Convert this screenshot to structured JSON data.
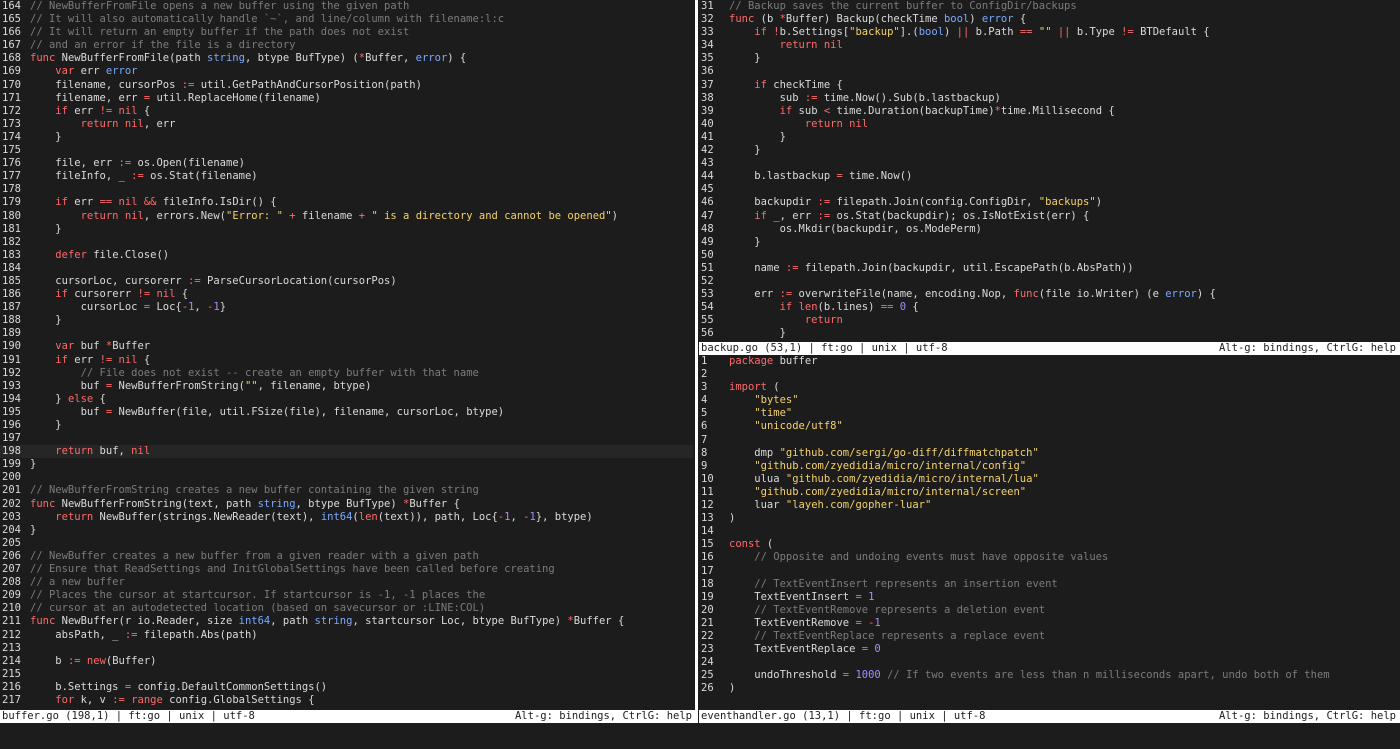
{
  "left_pane": {
    "status_left": "buffer.go (198,1) | ft:go | unix | utf-8",
    "status_right": "Alt-g: bindings, CtrlG: help",
    "cursor_line": "198",
    "lines": [
      [
        "164",
        "// NewBufferFromFile opens a new buffer using the given path"
      ],
      [
        "165",
        "// It will also automatically handle `~`, and line/column with filename:l:c"
      ],
      [
        "166",
        "// It will return an empty buffer if the path does not exist"
      ],
      [
        "167",
        "// and an error if the file is a directory"
      ],
      [
        "168",
        "func NewBufferFromFile(path string, btype BufType) (*Buffer, error) {"
      ],
      [
        "169",
        "    var err error"
      ],
      [
        "170",
        "    filename, cursorPos := util.GetPathAndCursorPosition(path)"
      ],
      [
        "171",
        "    filename, err = util.ReplaceHome(filename)"
      ],
      [
        "172",
        "    if err != nil {"
      ],
      [
        "173",
        "        return nil, err"
      ],
      [
        "174",
        "    }"
      ],
      [
        "175",
        ""
      ],
      [
        "176",
        "    file, err := os.Open(filename)"
      ],
      [
        "177",
        "    fileInfo, _ := os.Stat(filename)"
      ],
      [
        "178",
        ""
      ],
      [
        "179",
        "    if err == nil && fileInfo.IsDir() {"
      ],
      [
        "180",
        "        return nil, errors.New(\"Error: \" + filename + \" is a directory and cannot be opened\")"
      ],
      [
        "181",
        "    }"
      ],
      [
        "182",
        ""
      ],
      [
        "183",
        "    defer file.Close()"
      ],
      [
        "184",
        ""
      ],
      [
        "185",
        "    cursorLoc, cursorerr := ParseCursorLocation(cursorPos)"
      ],
      [
        "186",
        "    if cursorerr != nil {"
      ],
      [
        "187",
        "        cursorLoc = Loc{-1, -1}"
      ],
      [
        "188",
        "    }"
      ],
      [
        "189",
        ""
      ],
      [
        "190",
        "    var buf *Buffer"
      ],
      [
        "191",
        "    if err != nil {"
      ],
      [
        "192",
        "        // File does not exist -- create an empty buffer with that name"
      ],
      [
        "193",
        "        buf = NewBufferFromString(\"\", filename, btype)"
      ],
      [
        "194",
        "    } else {"
      ],
      [
        "195",
        "        buf = NewBuffer(file, util.FSize(file), filename, cursorLoc, btype)"
      ],
      [
        "196",
        "    }"
      ],
      [
        "197",
        ""
      ],
      [
        "198",
        "    return buf, nil"
      ],
      [
        "199",
        "}"
      ],
      [
        "200",
        ""
      ],
      [
        "201",
        "// NewBufferFromString creates a new buffer containing the given string"
      ],
      [
        "202",
        "func NewBufferFromString(text, path string, btype BufType) *Buffer {"
      ],
      [
        "203",
        "    return NewBuffer(strings.NewReader(text), int64(len(text)), path, Loc{-1, -1}, btype)"
      ],
      [
        "204",
        "}"
      ],
      [
        "205",
        ""
      ],
      [
        "206",
        "// NewBuffer creates a new buffer from a given reader with a given path"
      ],
      [
        "207",
        "// Ensure that ReadSettings and InitGlobalSettings have been called before creating"
      ],
      [
        "208",
        "// a new buffer"
      ],
      [
        "209",
        "// Places the cursor at startcursor. If startcursor is -1, -1 places the"
      ],
      [
        "210",
        "// cursor at an autodetected location (based on savecursor or :LINE:COL)"
      ],
      [
        "211",
        "func NewBuffer(r io.Reader, size int64, path string, startcursor Loc, btype BufType) *Buffer {"
      ],
      [
        "212",
        "    absPath, _ := filepath.Abs(path)"
      ],
      [
        "213",
        ""
      ],
      [
        "214",
        "    b := new(Buffer)"
      ],
      [
        "215",
        ""
      ],
      [
        "216",
        "    b.Settings = config.DefaultCommonSettings()"
      ],
      [
        "217",
        "    for k, v := range config.GlobalSettings {"
      ]
    ]
  },
  "top_right_pane": {
    "status_left": "backup.go (53,1) | ft:go | unix | utf-8",
    "status_right": "Alt-g: bindings, CtrlG: help",
    "lines": [
      [
        "31",
        "// Backup saves the current buffer to ConfigDir/backups"
      ],
      [
        "32",
        "func (b *Buffer) Backup(checkTime bool) error {"
      ],
      [
        "33",
        "    if !b.Settings[\"backup\"].(bool) || b.Path == \"\" || b.Type != BTDefault {"
      ],
      [
        "34",
        "        return nil"
      ],
      [
        "35",
        "    }"
      ],
      [
        "36",
        ""
      ],
      [
        "37",
        "    if checkTime {"
      ],
      [
        "38",
        "        sub := time.Now().Sub(b.lastbackup)"
      ],
      [
        "39",
        "        if sub < time.Duration(backupTime)*time.Millisecond {"
      ],
      [
        "40",
        "            return nil"
      ],
      [
        "41",
        "        }"
      ],
      [
        "42",
        "    }"
      ],
      [
        "43",
        ""
      ],
      [
        "44",
        "    b.lastbackup = time.Now()"
      ],
      [
        "45",
        ""
      ],
      [
        "46",
        "    backupdir := filepath.Join(config.ConfigDir, \"backups\")"
      ],
      [
        "47",
        "    if _, err := os.Stat(backupdir); os.IsNotExist(err) {"
      ],
      [
        "48",
        "        os.Mkdir(backupdir, os.ModePerm)"
      ],
      [
        "49",
        "    }"
      ],
      [
        "50",
        ""
      ],
      [
        "51",
        "    name := filepath.Join(backupdir, util.EscapePath(b.AbsPath))"
      ],
      [
        "52",
        ""
      ],
      [
        "53",
        "    err := overwriteFile(name, encoding.Nop, func(file io.Writer) (e error) {"
      ],
      [
        "54",
        "        if len(b.lines) == 0 {"
      ],
      [
        "55",
        "            return"
      ],
      [
        "56",
        "        }"
      ]
    ]
  },
  "bottom_right_pane": {
    "status_left": "eventhandler.go (13,1) | ft:go | unix | utf-8",
    "status_right": "Alt-g: bindings, CtrlG: help",
    "lines": [
      [
        "1",
        "package buffer"
      ],
      [
        "2",
        ""
      ],
      [
        "3",
        "import ("
      ],
      [
        "4",
        "    \"bytes\""
      ],
      [
        "5",
        "    \"time\""
      ],
      [
        "6",
        "    \"unicode/utf8\""
      ],
      [
        "7",
        ""
      ],
      [
        "8",
        "    dmp \"github.com/sergi/go-diff/diffmatchpatch\""
      ],
      [
        "9",
        "    \"github.com/zyedidia/micro/internal/config\""
      ],
      [
        "10",
        "    ulua \"github.com/zyedidia/micro/internal/lua\""
      ],
      [
        "11",
        "    \"github.com/zyedidia/micro/internal/screen\""
      ],
      [
        "12",
        "    luar \"layeh.com/gopher-luar\""
      ],
      [
        "13",
        ")"
      ],
      [
        "14",
        ""
      ],
      [
        "15",
        "const ("
      ],
      [
        "16",
        "    // Opposite and undoing events must have opposite values"
      ],
      [
        "17",
        ""
      ],
      [
        "18",
        "    // TextEventInsert represents an insertion event"
      ],
      [
        "19",
        "    TextEventInsert = 1"
      ],
      [
        "20",
        "    // TextEventRemove represents a deletion event"
      ],
      [
        "21",
        "    TextEventRemove = -1"
      ],
      [
        "22",
        "    // TextEventReplace represents a replace event"
      ],
      [
        "23",
        "    TextEventReplace = 0"
      ],
      [
        "24",
        ""
      ],
      [
        "25",
        "    undoThreshold = 1000 // If two events are less than n milliseconds apart, undo both of them"
      ],
      [
        "26",
        ")"
      ]
    ]
  },
  "colors": {
    "background": "#1c1c1c",
    "keyword": "#ff6a6a",
    "type": "#7aa9ff",
    "string": "#f5d26b",
    "number": "#a58bff",
    "comment": "#7b7b7b",
    "statusbar": "#ffffff"
  }
}
